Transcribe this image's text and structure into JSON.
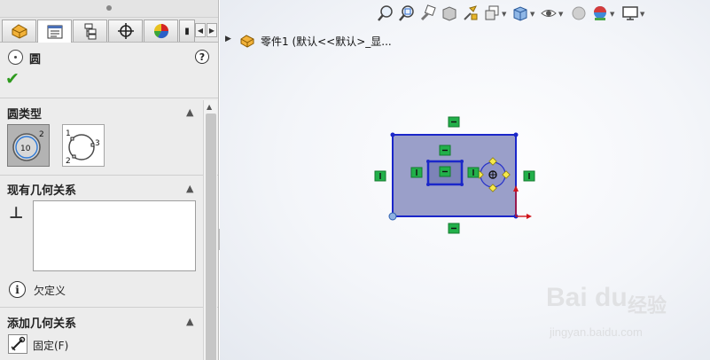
{
  "property_manager": {
    "tabs": [
      {
        "name": "feature-manager",
        "icon": "feature-tree-icon"
      },
      {
        "name": "property-manager",
        "icon": "property-list-icon"
      },
      {
        "name": "configuration-manager",
        "icon": "configuration-icon"
      },
      {
        "name": "dimxpert-manager",
        "icon": "crosshair-icon"
      },
      {
        "name": "display-manager",
        "icon": "display-pie-icon"
      }
    ],
    "feature_title": "圆",
    "groups": {
      "circle_type": "圆类型",
      "existing_relations": "现有几何关系",
      "add_relations": "添加几何关系"
    },
    "status": "欠定义",
    "add_relation_fix": "固定(F)",
    "circle_type_options": {
      "center": {
        "label_a": "10",
        "label_b": "2"
      },
      "perimeter": {
        "label_1": "1",
        "label_2": "2",
        "label_3": "3"
      }
    }
  },
  "graphics": {
    "part_name": "零件1  (默认<<默认>_显...",
    "heads_up_icons": [
      "zoom-to-fit-icon",
      "zoom-to-area-icon",
      "previous-view-icon",
      "section-view-icon",
      "dynamic-annotation-icon",
      "view-orientation-icon",
      "display-style-icon",
      "hide-show-icon",
      "edit-appearance-icon",
      "apply-scene-icon",
      "view-settings-icon"
    ],
    "watermark": {
      "brand": "Bai du",
      "cn": "经验",
      "url": "jingyan.baidu.com"
    }
  },
  "colors": {
    "sketch_line": "#1b27c9",
    "sketch_fill": "#9a9fc9",
    "relation_green": "#22b04a",
    "ok_green": "#2e9a1e",
    "handle_yellow": "#f6e94a",
    "origin_red": "#d0141b"
  }
}
